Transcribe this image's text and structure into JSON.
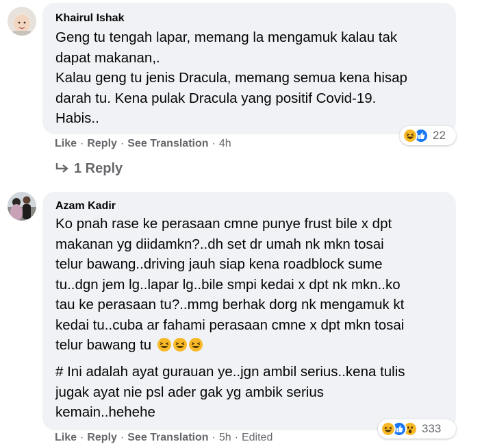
{
  "comments": [
    {
      "author": "Khairul Ishak",
      "lines": [
        "Geng tu tengah lapar, memang la mengamuk kalau tak",
        "dapat makanan,.",
        "Kalau geng tu jenis Dracula, memang semua kena hisap",
        "darah tu. Kena pulak Dracula yang positif Covid-19.",
        "Habis.."
      ],
      "reactions": {
        "icons": [
          "haha-icon",
          "like-icon"
        ],
        "count": "22"
      },
      "actions": {
        "like": "Like",
        "reply": "Reply",
        "translate": "See Translation",
        "time": "4h"
      },
      "replies_label": "1 Reply"
    },
    {
      "author": "Azam Kadir",
      "lines": [
        "Ko pnah rase ke perasaan cmne punye frust bile x dpt",
        "makanan yg diidamkn?..dh set dr umah nk mkn tosai",
        "telur bawang..driving jauh siap kena roadblock sume",
        "tu..dgn jem lg..lapar lg..bile smpi kedai x dpt nk mkn..ko",
        "tau ke perasaan tu?..mmg berhak dorg nk mengamuk kt",
        "kedai tu..cuba ar fahami perasaan cmne x dpt mkn tosai",
        "telur bawang tu"
      ],
      "inline_emojis": [
        "laughing-emoji",
        "laughing-emoji",
        "laughing-emoji"
      ],
      "lines2": [
        "# Ini adalah ayat gurauan ye..jgn ambil serius..kena tulis",
        "jugak ayat nie psl ader gak yg ambik serius",
        "kemain..hehehe"
      ],
      "reactions": {
        "icons": [
          "haha-icon",
          "like-icon",
          "wow-icon"
        ],
        "count": "333"
      },
      "actions": {
        "like": "Like",
        "reply": "Reply",
        "translate": "See Translation",
        "time": "5h",
        "edited": "Edited"
      }
    }
  ],
  "colors": {
    "bubble": "#f0f2f5",
    "secondary_text": "#65676b",
    "like_blue": "#1877f2",
    "haha_yellow": "#f7b928"
  }
}
